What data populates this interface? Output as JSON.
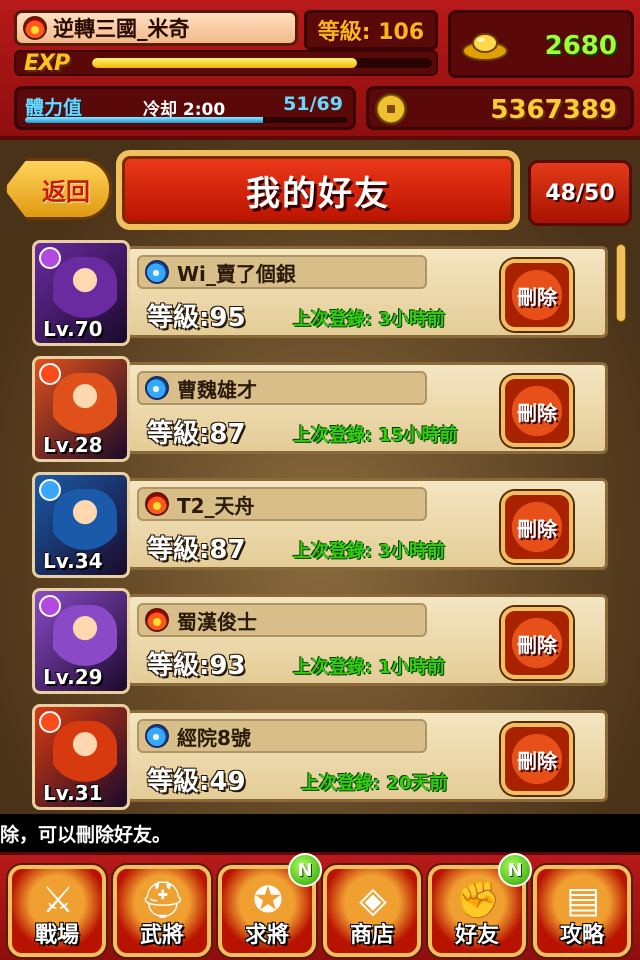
{
  "player": {
    "name": "逆轉三國_米奇",
    "level_text": "等級: 106",
    "exp_label": "EXP",
    "exp_progress": 0.78
  },
  "currency": {
    "gold": "2680",
    "coins": "5367389"
  },
  "stamina": {
    "label": "體力值",
    "cooldown": "冷却 2:00",
    "value": "51/69",
    "progress": 0.74
  },
  "header": {
    "back_label": "返回",
    "title": "我的好友",
    "count": "48/50"
  },
  "friends": [
    {
      "name": "Wi_賣了個銀",
      "element": "water",
      "avatar_level": "Lv.70",
      "level": "等級:95",
      "last_login": "上次登錄: 3小時前",
      "delete_label": "刪除",
      "badge_color": "#b24adf",
      "avatar_color": "#6a2aa0"
    },
    {
      "name": "曹魏雄才",
      "element": "water",
      "avatar_level": "Lv.28",
      "level": "等級:87",
      "last_login": "上次登錄: 15小時前",
      "delete_label": "刪除",
      "badge_color": "#ff4a1a",
      "avatar_color": "#e0501a"
    },
    {
      "name": "T2_天舟",
      "element": "fire",
      "avatar_level": "Lv.34",
      "level": "等級:87",
      "last_login": "上次登錄: 3小時前",
      "delete_label": "刪除",
      "badge_color": "#38a8ff",
      "avatar_color": "#1a5aa8"
    },
    {
      "name": "蜀漢俊士",
      "element": "fire",
      "avatar_level": "Lv.29",
      "level": "等級:93",
      "last_login": "上次登錄: 1小時前",
      "delete_label": "刪除",
      "badge_color": "#b24adf",
      "avatar_color": "#8a4ac8"
    },
    {
      "name": "經院8號",
      "element": "water",
      "avatar_level": "Lv.31",
      "level": "等級:49",
      "last_login": "上次登錄: 20天前",
      "delete_label": "刪除",
      "badge_color": "#ff4a1a",
      "avatar_color": "#d83a10"
    }
  ],
  "hint": "除，可以刪除好友。",
  "nav": [
    {
      "label": "戰場",
      "icon": "crossed-swords-icon",
      "new": false
    },
    {
      "label": "武將",
      "icon": "helmet-icon",
      "new": false
    },
    {
      "label": "求將",
      "icon": "summon-seal-icon",
      "new": true,
      "new_label": "N"
    },
    {
      "label": "商店",
      "icon": "gold-ingots-icon",
      "new": false
    },
    {
      "label": "好友",
      "icon": "handshake-icon",
      "new": true,
      "new_label": "N"
    },
    {
      "label": "攻略",
      "icon": "guide-book-icon",
      "new": false
    }
  ]
}
